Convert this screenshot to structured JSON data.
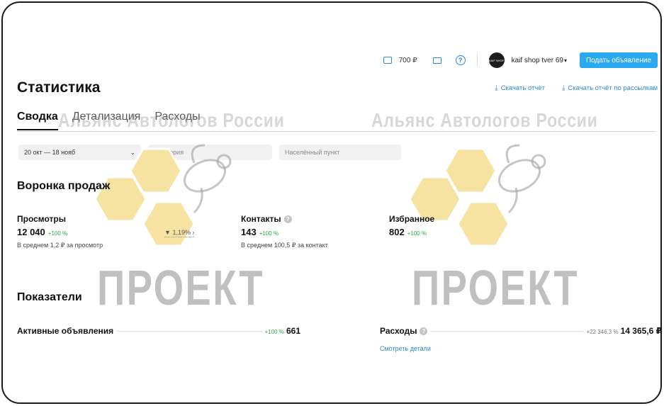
{
  "header": {
    "balance": "700 ₽",
    "user_name": "kaif shop tver 69",
    "avatar_text": "KAIF SHOP",
    "post_button": "Подать объявление"
  },
  "page": {
    "title": "Статистика",
    "download_report": "Скачать отчёт",
    "download_mailing_report": "Скачать отчёт по рассылкам"
  },
  "tabs": [
    {
      "label": "Сводка",
      "active": true
    },
    {
      "label": "Детализация",
      "active": false
    },
    {
      "label": "Расходы",
      "active": false
    }
  ],
  "filters": {
    "date_range": "20 окт — 18 нояб",
    "category_placeholder": "Категория",
    "city_placeholder": "Населённый пункт"
  },
  "funnel": {
    "title": "Воронка продаж",
    "views": {
      "label": "Просмотры",
      "value": "12 040",
      "delta": "+100 %",
      "sub": "В среднем 1,2 ₽ за просмотр"
    },
    "conversion": "1,19% ›",
    "contacts": {
      "label": "Контакты",
      "value": "143",
      "delta": "+100 %",
      "sub": "В среднем 100,5 ₽ за контакт"
    },
    "favorites": {
      "label": "Избранное",
      "value": "802",
      "delta": "+100 %"
    }
  },
  "indicators": {
    "title": "Показатели",
    "active_ads": {
      "label": "Активные объявления",
      "delta": "+100 %",
      "value": "661"
    },
    "expenses": {
      "label": "Расходы",
      "delta": "+22 346,3 %",
      "value": "14 365,6 ₽",
      "details_link": "Смотреть детали"
    }
  },
  "watermark": {
    "org": "Альянс Автологов России",
    "project": "ПРОЕКТ"
  },
  "colors": {
    "accent": "#2b8ad6",
    "button": "#2aa9f1",
    "positive": "#2ea543",
    "honeycomb": "#f7e3a1"
  }
}
